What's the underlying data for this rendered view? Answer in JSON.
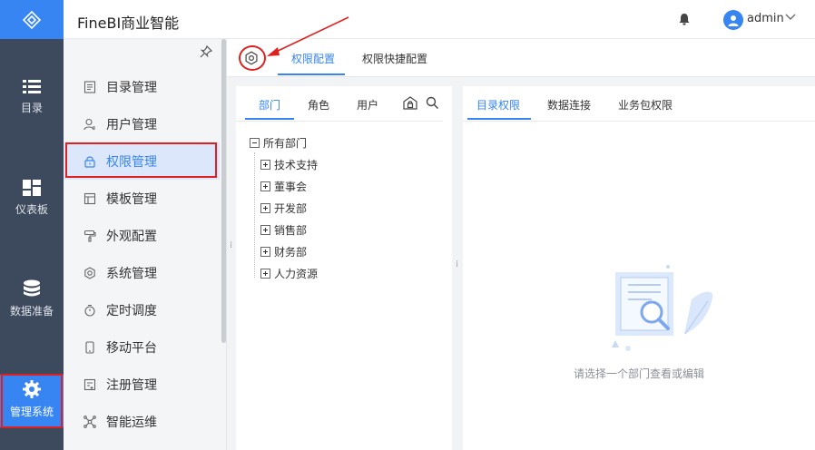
{
  "header": {
    "title": "FineBI商业智能",
    "user": "admin"
  },
  "rail": [
    {
      "label": "目录",
      "icon": "list-icon"
    },
    {
      "label": "仪表板",
      "icon": "dashboard-icon"
    },
    {
      "label": "数据准备",
      "icon": "database-icon"
    },
    {
      "label": "管理系统",
      "icon": "gear-icon"
    }
  ],
  "subnav": [
    {
      "label": "目录管理"
    },
    {
      "label": "用户管理"
    },
    {
      "label": "权限管理"
    },
    {
      "label": "模板管理"
    },
    {
      "label": "外观配置"
    },
    {
      "label": "系统管理"
    },
    {
      "label": "定时调度"
    },
    {
      "label": "移动平台"
    },
    {
      "label": "注册管理"
    },
    {
      "label": "智能运维"
    }
  ],
  "main_tabs": [
    {
      "label": "权限配置"
    },
    {
      "label": "权限快捷配置"
    }
  ],
  "left_tabs": [
    {
      "label": "部门"
    },
    {
      "label": "角色"
    },
    {
      "label": "用户"
    }
  ],
  "right_tabs": [
    {
      "label": "目录权限"
    },
    {
      "label": "数据连接"
    },
    {
      "label": "业务包权限"
    }
  ],
  "tree": {
    "root": "所有部门",
    "children": [
      "技术支持",
      "董事会",
      "开发部",
      "销售部",
      "财务部",
      "人力资源"
    ]
  },
  "empty_hint": "请选择一个部门查看或编辑",
  "colors": {
    "accent": "#3685f2",
    "rail": "#3d4a5d",
    "highlight": "#e02020"
  }
}
